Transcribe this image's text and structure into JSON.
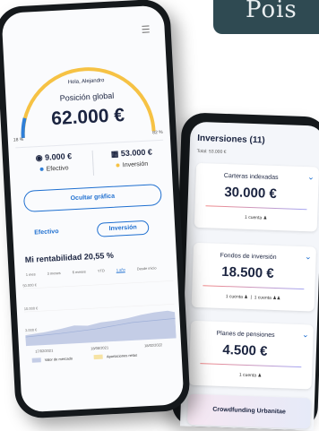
{
  "banner": {
    "text": "Pois"
  },
  "main_phone": {
    "greeting": "Hola, Alejandro",
    "position_label": "Posición global",
    "position_value": "62.000 €",
    "pct_left": "18 %",
    "pct_right": "82 %",
    "gauge_fraction": 0.82,
    "cash": {
      "value": "9.000 €",
      "label": "Efectivo"
    },
    "investment": {
      "value": "53.000 €",
      "label": "Inversión"
    },
    "hide_chart_button": "Ocultar gráfica",
    "tabs": {
      "cash": "Efectivo",
      "investment": "Inversión"
    },
    "return_label": "Mi rentabilidad 20,55 %",
    "periods": [
      "1 mes",
      "3 meses",
      "6 meses",
      "YTD",
      "1 año",
      "Desde inicio"
    ],
    "active_period": "1 año",
    "y_ticks": [
      "50.000 €",
      "10.000 €",
      "3.000 €"
    ],
    "x_ticks": [
      "17/02/2021",
      "18/08/2021",
      "18/02/2022"
    ],
    "legend": {
      "market": "Valor de mercado",
      "contributions": "Aportaciones netas"
    },
    "colors": {
      "accent": "#1e6fd0",
      "gauge_orange": "#f6c244",
      "gauge_blue": "#2f7fd8",
      "cash_dot": "#2f7fd8",
      "investment_dot": "#f6c244"
    }
  },
  "second_phone": {
    "title": "Inversiones (11)",
    "total": "Total: 53.000 €",
    "cards": [
      {
        "name": "Carteras indexadas",
        "amount": "30.000 €",
        "accounts": "1 cuenta"
      },
      {
        "name": "Fondos de inversión",
        "amount": "18.500 €",
        "accounts": "1 cuenta",
        "accounts2": "1 cuenta"
      },
      {
        "name": "Planes de pensiones",
        "amount": "4.500 €",
        "accounts": "1 cuenta"
      },
      {
        "name": "Crowdfunding Urbanitae"
      }
    ]
  }
}
